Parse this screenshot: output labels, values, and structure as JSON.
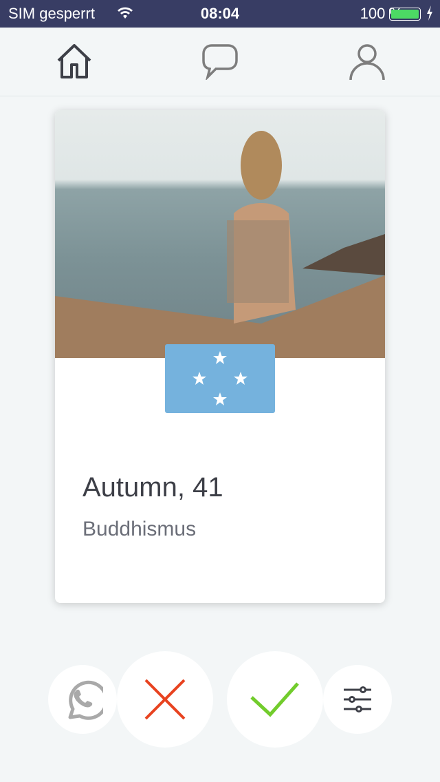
{
  "status": {
    "carrier": "SIM gesperrt",
    "time": "08:04",
    "battery": "100 %"
  },
  "nav": {
    "items": [
      "home",
      "chat",
      "profile"
    ]
  },
  "profile": {
    "name_age": "Autumn, 41",
    "religion": "Buddhismus",
    "flag": "Micronesia"
  },
  "colors": {
    "status_bar": "#383d64",
    "reject": "#e8421f",
    "accept": "#72cc2c",
    "flag": "#75b2dd"
  }
}
